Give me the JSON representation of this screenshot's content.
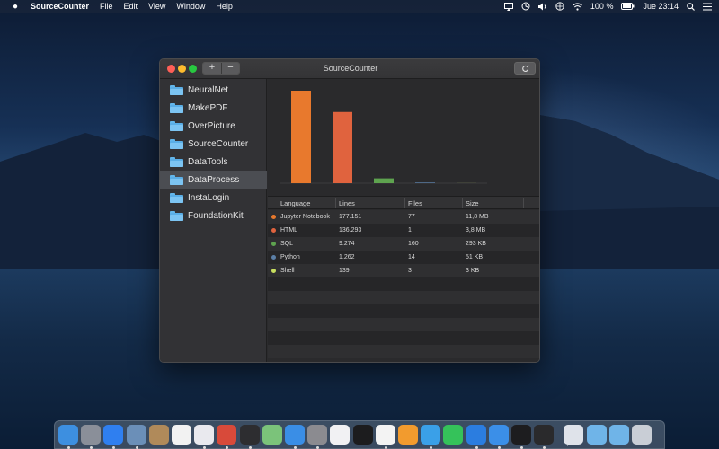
{
  "menubar": {
    "apple_icon": "apple-logo-icon",
    "app_name": "SourceCounter",
    "menus": [
      "File",
      "Edit",
      "View",
      "Window",
      "Help"
    ],
    "battery": "100 %",
    "clock": "Jue 23:14"
  },
  "window": {
    "title": "SourceCounter",
    "add_label": "+",
    "remove_label": "−",
    "refresh_icon": "refresh-icon"
  },
  "sidebar": {
    "items": [
      {
        "label": "NeuralNet"
      },
      {
        "label": "MakePDF"
      },
      {
        "label": "OverPicture"
      },
      {
        "label": "SourceCounter"
      },
      {
        "label": "DataTools"
      },
      {
        "label": "DataProcess"
      },
      {
        "label": "InstaLogin"
      },
      {
        "label": "FoundationKit"
      }
    ],
    "selected_index": 5
  },
  "chart_data": {
    "type": "bar",
    "categories": [
      "Jupyter Notebook",
      "HTML",
      "SQL",
      "Python",
      "Shell"
    ],
    "values": [
      177151,
      136293,
      9274,
      1262,
      139
    ],
    "colors": [
      "#e8792d",
      "#e0633e",
      "#5ea34f",
      "#5b7fa6",
      "#c8de5f"
    ]
  },
  "table": {
    "headers": [
      "Language",
      "Lines",
      "Files",
      "Size"
    ],
    "rows": [
      {
        "language": "Jupyter Notebook",
        "lines": "177.151",
        "files": "77",
        "size": "11,8 MB",
        "color": "#e8792d"
      },
      {
        "language": "HTML",
        "lines": "136.293",
        "files": "1",
        "size": "3,8 MB",
        "color": "#e0633e"
      },
      {
        "language": "SQL",
        "lines": "9.274",
        "files": "160",
        "size": "293 KB",
        "color": "#5ea34f"
      },
      {
        "language": "Python",
        "lines": "1.262",
        "files": "14",
        "size": "51 KB",
        "color": "#5b7fa6"
      },
      {
        "language": "Shell",
        "lines": "139",
        "files": "3",
        "size": "3 KB",
        "color": "#c8de5f"
      }
    ]
  },
  "dock": {
    "apps": [
      {
        "name": "finder-icon",
        "color": "#3d8fe0"
      },
      {
        "name": "launchpad-icon",
        "color": "#8a8f99"
      },
      {
        "name": "app-store-icon",
        "color": "#2f7ff0"
      },
      {
        "name": "preview-icon",
        "color": "#6b8fb8"
      },
      {
        "name": "contacts-icon",
        "color": "#b08a5a"
      },
      {
        "name": "calendar-icon",
        "color": "#f2f2f2"
      },
      {
        "name": "reminders-icon",
        "color": "#e9e9ee"
      },
      {
        "name": "photo-app-icon",
        "color": "#d84a3a"
      },
      {
        "name": "activity-monitor-icon",
        "color": "#2d2d30"
      },
      {
        "name": "maps-icon",
        "color": "#7bc37a"
      },
      {
        "name": "safari-icon",
        "color": "#3a8ee6"
      },
      {
        "name": "system-preferences-icon",
        "color": "#8b8b90"
      },
      {
        "name": "music-icon",
        "color": "#f1f1f3"
      },
      {
        "name": "apple-tv-icon",
        "color": "#1c1c1e"
      },
      {
        "name": "photos-icon",
        "color": "#f3f3f3"
      },
      {
        "name": "home-icon",
        "color": "#f29b2e"
      },
      {
        "name": "tweetbot-icon",
        "color": "#3aa0e8"
      },
      {
        "name": "whatsapp-icon",
        "color": "#35c25a"
      },
      {
        "name": "location-icon",
        "color": "#2b7de0"
      },
      {
        "name": "xcode-icon",
        "color": "#3b8fe8"
      },
      {
        "name": "terminal-icon",
        "color": "#1d1d1f"
      },
      {
        "name": "code-icon",
        "color": "#2a2a2c"
      },
      {
        "name": "home-folder-icon",
        "color": "#dfe3ea"
      },
      {
        "name": "folder-icon",
        "color": "#6fb4e8"
      },
      {
        "name": "downloads-folder-icon",
        "color": "#6fb4e8"
      },
      {
        "name": "trash-icon",
        "color": "#c9ced6"
      }
    ]
  }
}
